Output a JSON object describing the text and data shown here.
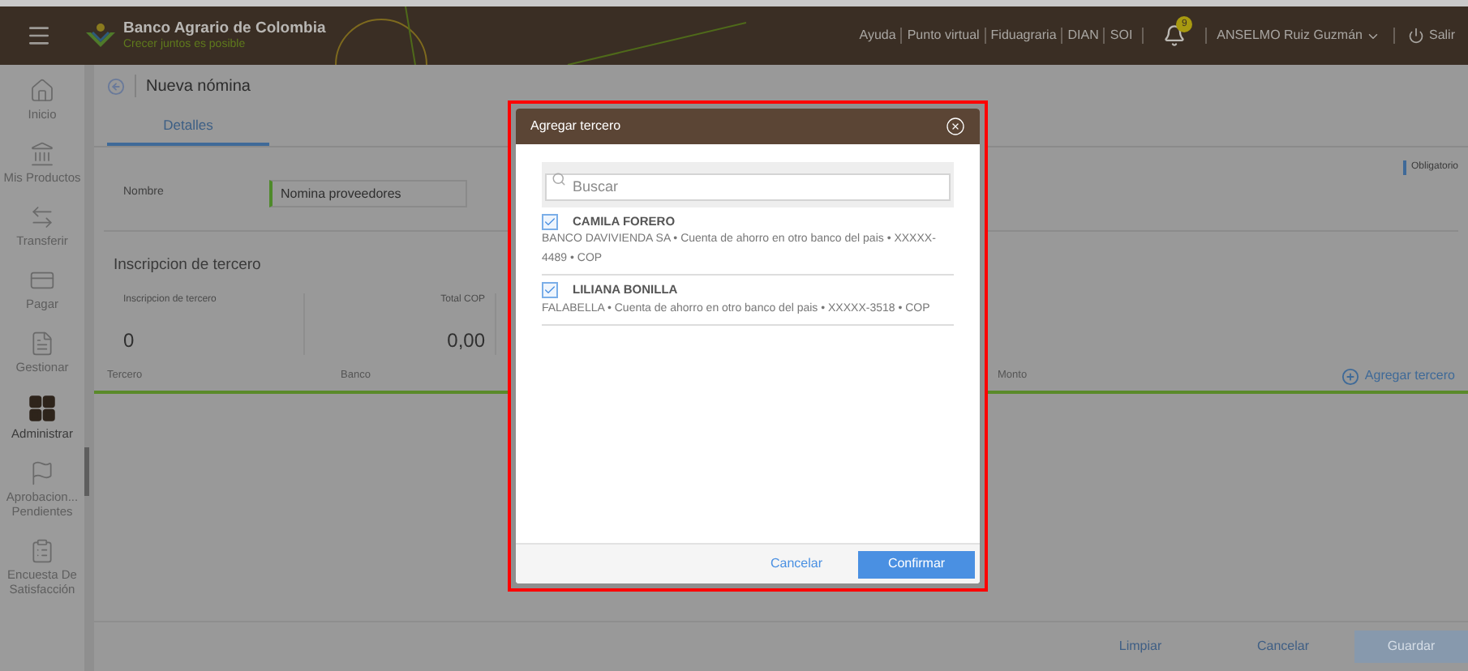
{
  "header": {
    "brand": {
      "name": "Banco Agrario de Colombia",
      "tagline": "Crecer juntos es posible"
    },
    "links": [
      "Ayuda",
      "Punto virtual",
      "Fiduagraria",
      "DIAN",
      "SOI"
    ],
    "notifications": {
      "count": "9"
    },
    "user": "ANSELMO Ruiz Guzmán",
    "logout": "Salir"
  },
  "sidebar": {
    "items": [
      {
        "label": "Inicio",
        "kind": "home",
        "selected": false
      },
      {
        "label": "Mis Productos",
        "kind": "bank",
        "selected": false
      },
      {
        "label": "Transferir",
        "kind": "transfer",
        "selected": false
      },
      {
        "label": "Pagar",
        "kind": "pay",
        "selected": false
      },
      {
        "label": "Gestionar",
        "kind": "manage",
        "selected": false
      },
      {
        "label": "Administrar",
        "kind": "grid",
        "selected": true
      },
      {
        "label": "Aprobacion... Pendientes",
        "kind": "flag",
        "selected": false
      },
      {
        "label": "Encuesta De Satisfacción",
        "kind": "survey",
        "selected": false
      }
    ]
  },
  "page": {
    "title": "Nueva nómina",
    "tabs": [
      {
        "label": "Detalles",
        "selected": true
      }
    ],
    "required_note": "Obligatorio",
    "name_field": {
      "label": "Nombre",
      "value": "Nomina proveedores"
    },
    "section_title": "Inscripcion de tercero",
    "stats": [
      {
        "label": "Inscripcion de tercero",
        "value": "0"
      },
      {
        "label": "Total COP",
        "value": "0,00"
      }
    ],
    "columns": [
      "Tercero",
      "Banco",
      "Monto"
    ],
    "add_button": "Agregar tercero"
  },
  "footer": {
    "buttons": [
      {
        "label": "Limpiar",
        "kind": "link",
        "disabled": false
      },
      {
        "label": "Cancelar",
        "kind": "link",
        "disabled": false
      },
      {
        "label": "Guardar",
        "kind": "primary",
        "disabled": true
      }
    ]
  },
  "dialog": {
    "title": "Agregar tercero",
    "search": {
      "placeholder": "Buscar"
    },
    "items": [
      {
        "name": "CAMILA FORERO",
        "details": "BANCO DAVIVIENDA SA • Cuenta de ahorro en otro banco del pais • XXXXX-4489 • COP",
        "checked": true
      },
      {
        "name": "LILIANA BONILLA",
        "details": "FALABELLA • Cuenta de ahorro en otro banco del pais • XXXXX-3518 • COP",
        "checked": true
      }
    ],
    "buttons": [
      {
        "label": "Cancelar",
        "kind": "link"
      },
      {
        "label": "Confirmar",
        "kind": "primary"
      }
    ]
  }
}
